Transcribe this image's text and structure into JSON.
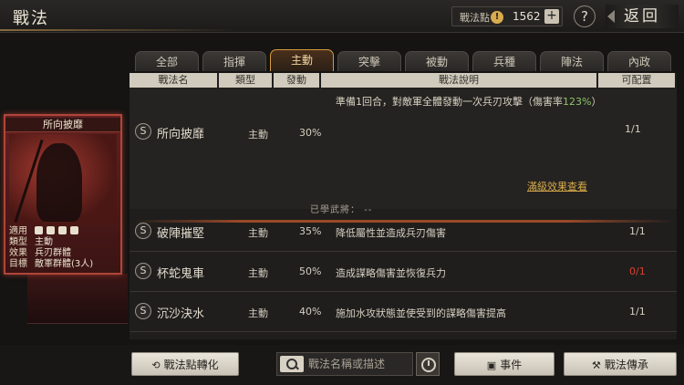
{
  "header": {
    "title": "戰法",
    "points_label": "戰法點",
    "points_icon": "coin-icon",
    "points_value": "1562",
    "plus_label": "+",
    "help_label": "?",
    "back_label": "返回"
  },
  "tabs": [
    "全部",
    "指揮",
    "主動",
    "突擊",
    "被動",
    "兵種",
    "陣法",
    "內政"
  ],
  "active_tab": "主動",
  "columns": {
    "name": "戰法名",
    "type": "類型",
    "rate": "發動",
    "desc": "戰法說明",
    "config": "可配置"
  },
  "rows": [
    {
      "badge": "S",
      "name": "所向披靡",
      "type": "主動",
      "rate": "30%",
      "desc_before": "準備1回合，對敵軍全體發動一次兵刃攻擊（傷害率",
      "desc_highlight": "123%",
      "desc_after": "）",
      "config": "1/1",
      "full_effect_link": "滿級效果查看",
      "learned_label": "已學武將：",
      "learned_value": "--"
    },
    {
      "badge": "S",
      "name": "破陣摧堅",
      "type": "主動",
      "rate": "35%",
      "desc": "降低屬性並造成兵刃傷害",
      "config": "1/1"
    },
    {
      "badge": "S",
      "name": "杯蛇鬼車",
      "type": "主動",
      "rate": "50%",
      "desc": "造成謀略傷害並恢復兵力",
      "config": "0/1"
    },
    {
      "badge": "S",
      "name": "沉沙決水",
      "type": "主動",
      "rate": "40%",
      "desc": "施加水攻狀態並使受到的謀略傷害提高",
      "config": "1/1"
    }
  ],
  "card": {
    "name": "所向披靡",
    "info": [
      {
        "key": "適用",
        "value": ""
      },
      {
        "key": "類型",
        "value": "主動"
      },
      {
        "key": "效果",
        "value": "兵刃群體"
      },
      {
        "key": "目標",
        "value": "敵軍群體(3人)"
      }
    ],
    "applicable_icons": [
      "cavalry-icon",
      "shield-icon",
      "bow-icon",
      "siege-icon"
    ]
  },
  "footer": {
    "convert_label": "戰法點轉化",
    "search_placeholder": "戰法名稱或描述",
    "events_label": "事件",
    "inherit_label": "戰法傳承"
  },
  "colors": {
    "accent_gold": "#d6a94a",
    "highlight_green": "#8fc46a",
    "warning_red": "#d9412e",
    "active_tab_border": "#d59a3e"
  }
}
